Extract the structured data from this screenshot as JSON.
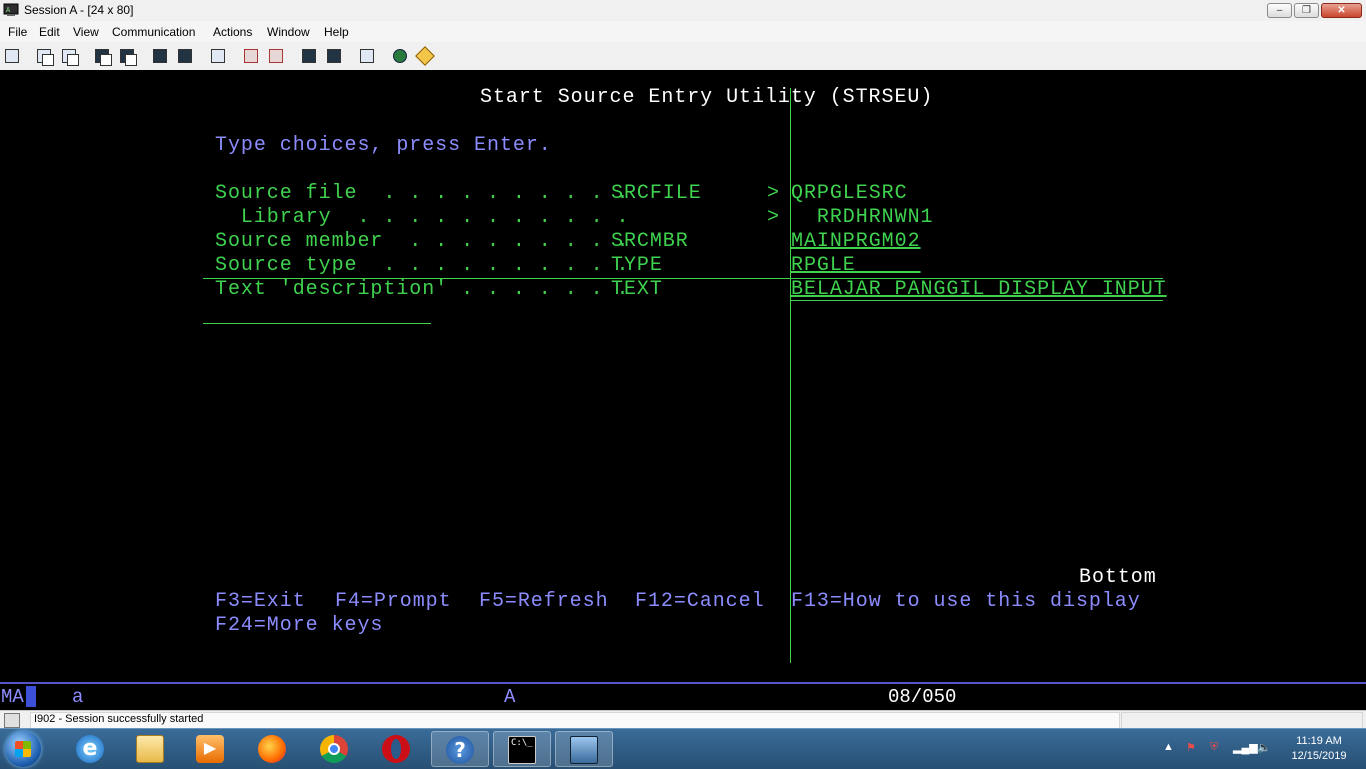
{
  "window": {
    "title": "Session A - [24 x 80]",
    "controls": {
      "minimize": "‒",
      "maximize": "❐",
      "close": "✕"
    }
  },
  "menu": [
    "File",
    "Edit",
    "View",
    "Communication",
    "Actions",
    "Window",
    "Help"
  ],
  "toolbar": {
    "icons": [
      "print-screen-icon",
      "copy-icon",
      "paste-icon",
      "send-icon",
      "receive-icon",
      "display-icon",
      "keyboard-map-icon",
      "macro-icon",
      "record-macro-icon",
      "play-macro-icon",
      "stop-macro-icon",
      "session-icon",
      "clipboard-icon",
      "globe-icon",
      "help-tag-icon"
    ]
  },
  "screen": {
    "title": "Start Source Entry Utility (STRSEU)",
    "instruction": "Type choices, press Enter.",
    "fields": [
      {
        "label": "Source file  . . . . . . . . . .",
        "keyword": "SRCFILE",
        "prompt": ">",
        "value": "QRPGLESRC"
      },
      {
        "label": "  Library  . . . . . . . . . . .",
        "keyword": "",
        "prompt": ">",
        "value": "  RRDHRNWN1"
      },
      {
        "label": "Source member  . . . . . . . . .",
        "keyword": "SRCMBR",
        "prompt": "",
        "value": "MAINPRGM02"
      },
      {
        "label": "Source type  . . . . . . . . . .",
        "keyword": "TYPE",
        "prompt": "",
        "value": "RPGLE     "
      },
      {
        "label": "Text 'description' . . . . . . .",
        "keyword": "TEXT",
        "prompt": "",
        "value": "BELAJAR PANGGIL DISPLAY INPUT"
      }
    ],
    "bottom": "Bottom",
    "fkeys_line1": [
      {
        "key": "F3=Exit"
      },
      {
        "key": "F4=Prompt"
      },
      {
        "key": "F5=Refresh"
      },
      {
        "key": "F12=Cancel"
      },
      {
        "key": "F13=How to use this display"
      }
    ],
    "fkeys_line2": "F24=More keys"
  },
  "oia": {
    "indicator": "MA",
    "shift": "a",
    "mode": "A",
    "cursor_position": "08/050"
  },
  "status": {
    "message": "I902 - Session successfully started"
  },
  "taskbar": {
    "apps": [
      "internet-explorer",
      "file-explorer",
      "media-player",
      "firefox",
      "chrome",
      "opera",
      "help",
      "command-prompt",
      "remote-desktop"
    ],
    "clock_time": "11:19 AM",
    "clock_date": "12/15/2019"
  },
  "colors": {
    "terminal_green": "#3fd24f",
    "terminal_blue": "#8c8cff",
    "terminal_white": "#ffffff",
    "oia_rule": "#5555cc"
  }
}
